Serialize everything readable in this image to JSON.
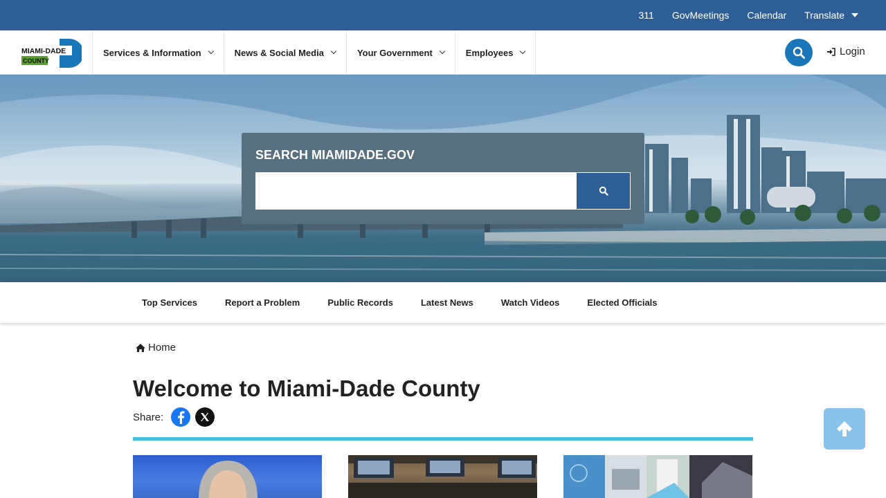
{
  "utility_bar": {
    "links": [
      "311",
      "GovMeetings",
      "Calendar"
    ],
    "translate_label": "Translate"
  },
  "logo": {
    "line1": "MIAMI-DADE",
    "line2": "COUNTY"
  },
  "main_nav": {
    "items": [
      "Services & Information",
      "News & Social Media",
      "Your Government",
      "Employees"
    ],
    "login_label": "Login"
  },
  "hero": {
    "search_title": "SEARCH MIAMIDADE.GOV",
    "search_placeholder": ""
  },
  "quick_links": [
    "Top Services",
    "Report a Problem",
    "Public Records",
    "Latest News",
    "Watch Videos",
    "Elected Officials"
  ],
  "breadcrumb": {
    "home_label": "Home"
  },
  "page": {
    "title": "Welcome to Miami-Dade County",
    "share_label": "Share:"
  },
  "colors": {
    "utility_bar": "#2d5f96",
    "search_panel": "#57707f",
    "accent_divider": "#45bfdd",
    "search_circle": "#1976b8",
    "back_to_top": "#8ac3ea"
  },
  "icons": {
    "search": "search-icon",
    "login": "sign-in-icon",
    "home": "home-icon",
    "facebook": "facebook-icon",
    "x": "x-icon",
    "back_to_top": "arrow-up-icon"
  }
}
